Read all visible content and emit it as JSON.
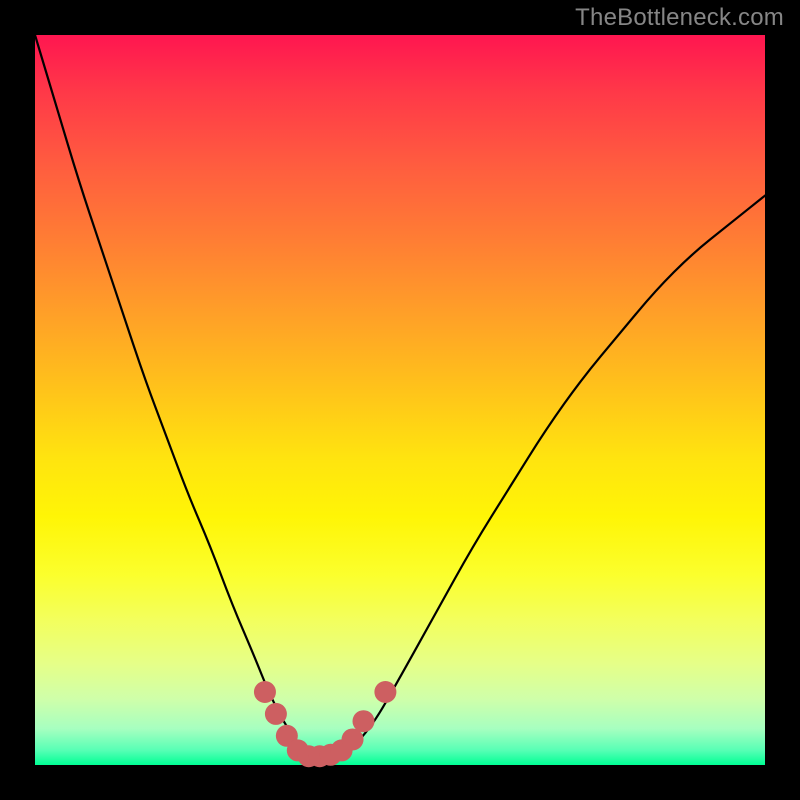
{
  "watermark": "TheBottleneck.com",
  "colors": {
    "background": "#000000",
    "gradient_top": "#ff1650",
    "gradient_bottom": "#00ff94",
    "curve": "#000000",
    "marker": "#cd5f61",
    "watermark": "#868686"
  },
  "chart_data": {
    "type": "line",
    "title": "",
    "xlabel": "",
    "ylabel": "",
    "xlim": [
      0,
      100
    ],
    "ylim": [
      0,
      100
    ],
    "annotations": [
      {
        "text": "TheBottleneck.com",
        "role": "watermark",
        "position": "top-right"
      }
    ],
    "series": [
      {
        "name": "bottleneck-curve",
        "x": [
          0,
          3,
          6,
          9,
          12,
          15,
          18,
          21,
          24,
          27,
          30,
          32,
          34,
          36,
          38,
          40,
          42,
          46,
          50,
          55,
          60,
          65,
          70,
          75,
          80,
          85,
          90,
          95,
          100
        ],
        "y": [
          100,
          90,
          80,
          71,
          62,
          53,
          45,
          37,
          30,
          22,
          15,
          10,
          6,
          3,
          1,
          0,
          1,
          5,
          12,
          21,
          30,
          38,
          46,
          53,
          59,
          65,
          70,
          74,
          78
        ]
      }
    ],
    "markers": [
      {
        "name": "valley-highlight",
        "x": [
          31.5,
          33,
          34.5,
          36,
          37.5,
          39,
          40.5,
          42,
          43.5,
          45
        ],
        "y": [
          10,
          7,
          4,
          2,
          1.2,
          1.2,
          1.4,
          2,
          3.5,
          6
        ]
      },
      {
        "name": "right-upper-dot",
        "x": [
          48
        ],
        "y": [
          10
        ]
      }
    ]
  }
}
